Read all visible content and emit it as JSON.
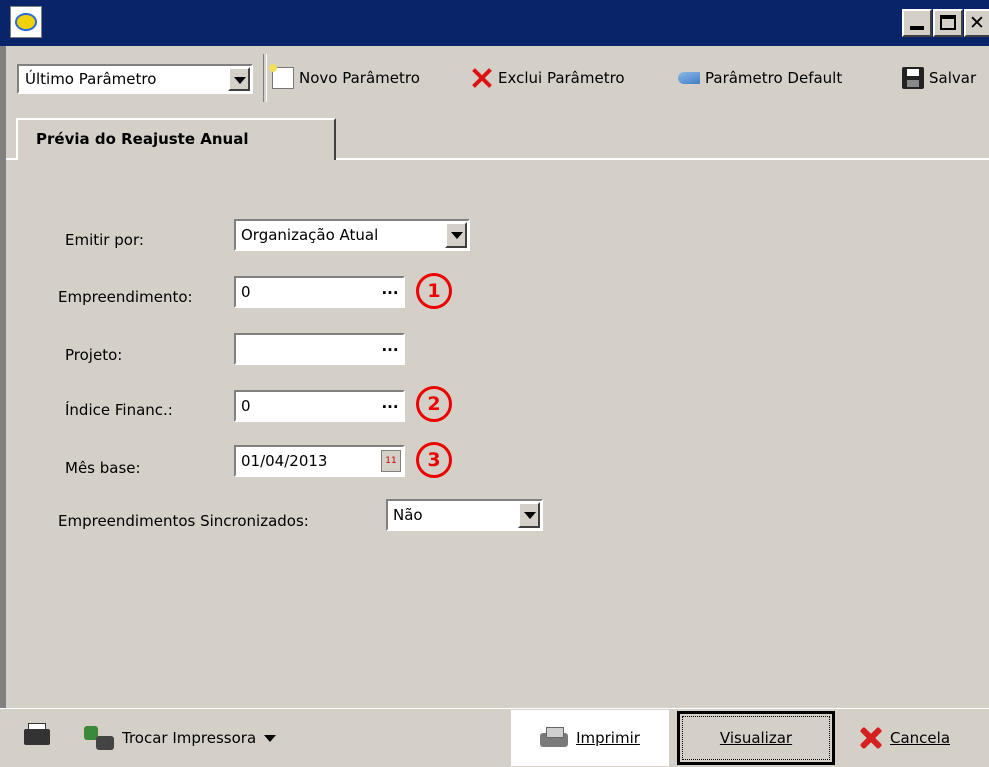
{
  "window": {
    "controls": {
      "minimize": "_",
      "maximize": "□",
      "close": "✕"
    }
  },
  "toolbar": {
    "parameter_select_value": "Último Parâmetro",
    "new_label": "Novo Parâmetro",
    "delete_label": "Exclui Parâmetro",
    "default_label": "Parâmetro Default",
    "save_label": "Salvar"
  },
  "tab": {
    "label": "Prévia do Reajuste Anual"
  },
  "form": {
    "emitir_por_label": "Emitir por:",
    "emitir_por_value": "Organização Atual",
    "empreendimento_label": "Empreendimento:",
    "empreendimento_value": "0",
    "projeto_label": "Projeto:",
    "projeto_value": "",
    "indice_label": "Índice Financ.:",
    "indice_value": "0",
    "mes_base_label": "Mês base:",
    "mes_base_value": "01/04/2013",
    "sincronizados_label": "Empreendimentos Sincronizados:",
    "sincronizados_value": "Não",
    "lookup_button": "...",
    "calendar_glyph": "11"
  },
  "markers": [
    "1",
    "2",
    "3"
  ],
  "bottom": {
    "trocar_label": "Trocar Impressora",
    "imprimir_label": "Imprimir",
    "visualizar_label": "Visualizar",
    "cancela_label": "Cancela"
  },
  "colors": {
    "titlebar": "#0a246a",
    "face": "#d4d0c8",
    "marker": "#e00000"
  }
}
